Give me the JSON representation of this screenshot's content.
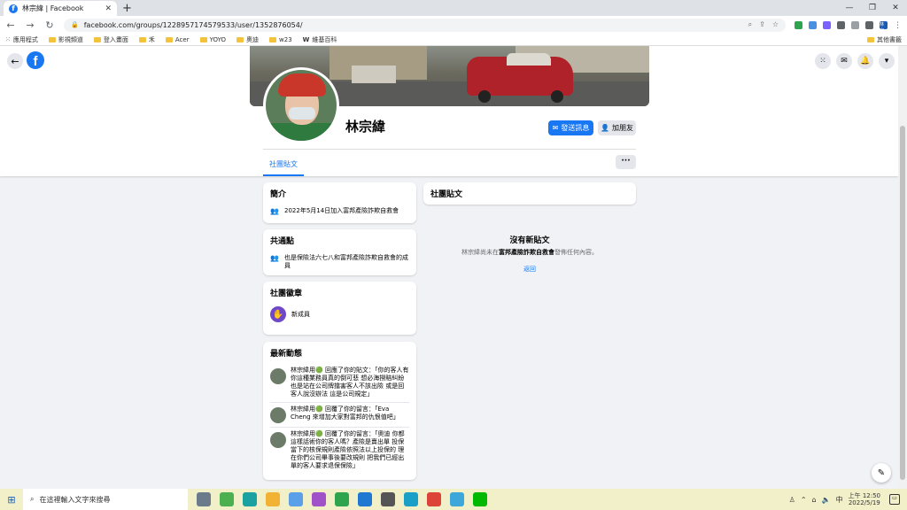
{
  "browser": {
    "tab_title": "林宗緯 | Facebook",
    "url": "facebook.com/groups/1228957174579533/user/1352876054/",
    "bookmarks": [
      "應用程式",
      "影視頻道",
      "登入畫面",
      "禾",
      "Acer",
      "YOYO",
      "奧迪",
      "w23",
      "維基百科"
    ],
    "other_bookmarks": "其他書籤",
    "profile_initials": "林宗"
  },
  "profile": {
    "name": "林宗緯",
    "message_label": "發送訊息",
    "add_friend_label": "加朋友",
    "tab_label": "社團貼文",
    "more_label": "···"
  },
  "intro": {
    "title": "簡介",
    "joined": "2022年5月14日加入富邦產險詐欺自救會"
  },
  "common": {
    "title": "共通點",
    "text": "也是保險法六七八和富邦產險詐欺自救會的成員"
  },
  "badges": {
    "title": "社團徽章",
    "badge_label": "新成員"
  },
  "activity": {
    "title": "最新動態",
    "items": [
      "林宗緯用🟢 回應了你的貼文：「你的客人有你這種業務員真的倒可悲 想必海撈賠糾紛也是站在公司牌擋害客人不該出險 或是回客人說沒辦法 這是公司規定」",
      "林宗緯用🟢 回覆了你的留言：「Eva Cheng 來增加大家對富邦的仇恨值吧」",
      "林宗緯用🟢 回覆了你的留言：「奧迪 你都這樣話術你的客人嗎？產險是賣出單 投保當下的核保規則產險依照法以上投保的 理在你們公司畢事後要改規則 把我們已經出單的客人要求退保保險」"
    ]
  },
  "posts": {
    "title": "社團貼文",
    "empty_title": "沒有新貼文",
    "empty_prefix": "林宗緯尚未在",
    "empty_group": "富邦產險詐欺自救會",
    "empty_suffix": "發佈任何內容。",
    "back_label": "返回"
  },
  "taskbar": {
    "search_placeholder": "在這裡輸入文字來搜尋",
    "time": "上午 12:50",
    "date": "2022/5/19",
    "ime": "中"
  }
}
